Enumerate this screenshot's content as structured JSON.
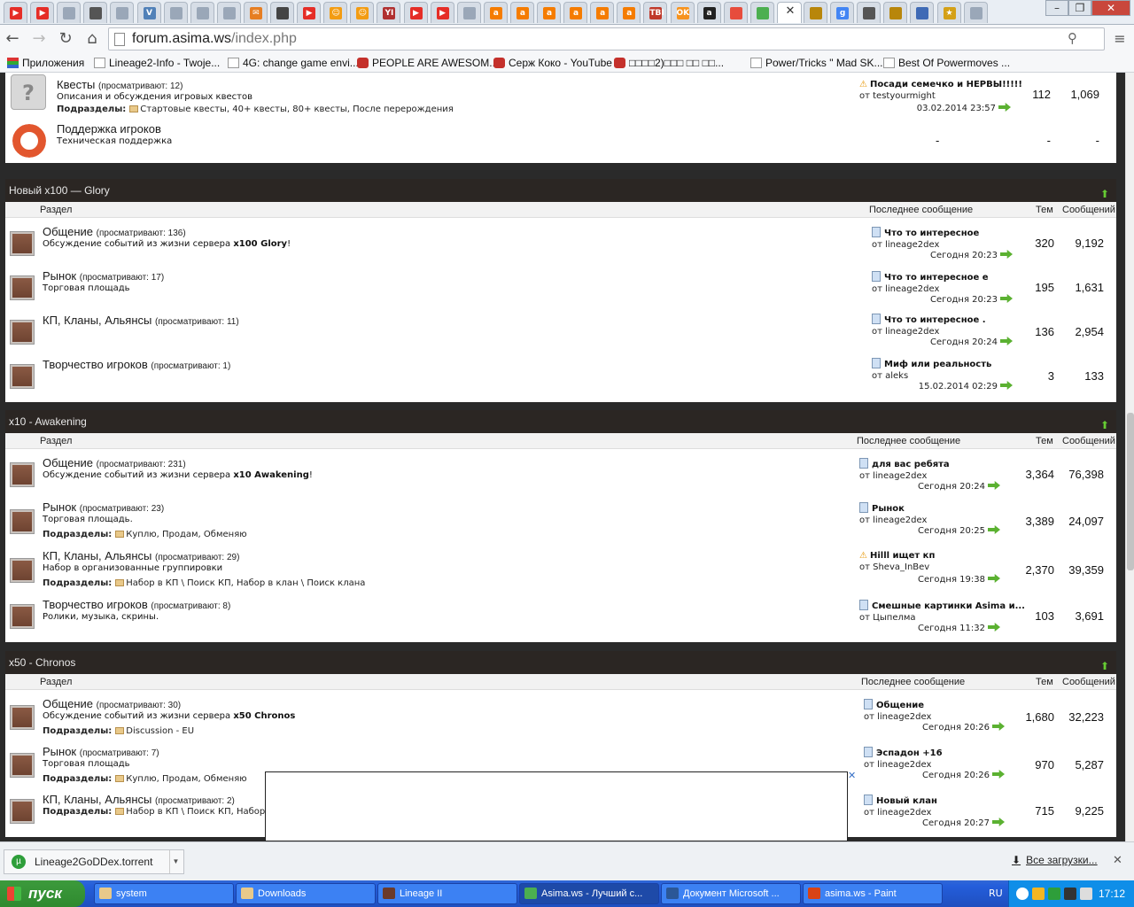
{
  "browser": {
    "url_host": "forum.asima.ws",
    "url_path": "/index.php",
    "tab_icons": [
      "youtube",
      "youtube",
      "page",
      "tool",
      "page",
      "vk",
      "page",
      "page",
      "page",
      "mail",
      "book",
      "youtube",
      "sun",
      "sun",
      "yii",
      "youtube",
      "youtube",
      "page",
      "amazon-a",
      "amazon-a",
      "amazon-a",
      "amazon-a",
      "amazon-a",
      "amazon-a",
      "tbi",
      "ok",
      "amazon",
      "camera",
      "chrome",
      "close",
      "shield",
      "google",
      "image",
      "shield",
      "wing",
      "star",
      "page"
    ],
    "active_tab_close": "✕",
    "bookmarks": [
      {
        "label": "Приложения",
        "icon": "apps"
      },
      {
        "label": "Lineage2-Info - Twoje...",
        "icon": "page"
      },
      {
        "label": "4G: change game envi...",
        "icon": "page"
      },
      {
        "label": "PEOPLE ARE AWESOM...",
        "icon": "yt"
      },
      {
        "label": "Серж Коко - YouTube",
        "icon": "yt"
      },
      {
        "label": "□□□□2)□□□ □□ □□...",
        "icon": "yt"
      },
      {
        "label": "Power/Tricks \" Mad SK...",
        "icon": "page"
      },
      {
        "label": "Best Of Powermoves ...",
        "icon": "page"
      }
    ]
  },
  "forum": {
    "top_rows": [
      {
        "name": "Квесты",
        "viewers": "(просматривают: 12)",
        "desc": "Описания и обсуждения игровых квестов",
        "subs_label": "Подразделы:",
        "subs": "Стартовые квесты, 40+ квесты, 80+ квесты, После перерождения",
        "last_title": "Посади семечко и НЕРВЫ!!!!!",
        "last_by": "от testyourmight",
        "last_date": "03.02.2014 23:57",
        "topics": "112",
        "posts": "1,069"
      },
      {
        "name": "Поддержка игроков",
        "desc": "Техническая поддержка",
        "last_title": "-",
        "topics": "-",
        "posts": "-"
      }
    ],
    "sections": [
      {
        "title": "Новый x100 — Glory",
        "col_section": "Раздел",
        "col_last": "Последнее сообщение",
        "col_topics": "Тем",
        "col_posts": "Сообщений",
        "rows": [
          {
            "name": "Общение",
            "viewers": "(просматривают: 136)",
            "desc": "Обсуждение событий из жизни сервера ",
            "desc_b": "x100 Glory",
            "desc_tail": "!",
            "last_title": "Что то интересное",
            "last_by": "от lineage2dex",
            "last_date": "Сегодня 20:23",
            "topics": "320",
            "posts": "9,192"
          },
          {
            "name": "Рынок",
            "viewers": "(просматривают: 17)",
            "desc": "Торговая площадь",
            "last_title": "Что то интересное е",
            "last_by": "от lineage2dex",
            "last_date": "Сегодня 20:23",
            "topics": "195",
            "posts": "1,631"
          },
          {
            "name": "КП, Кланы, Альянсы",
            "viewers": "(просматривают: 11)",
            "last_title": "Что то интересное .",
            "last_by": "от lineage2dex",
            "last_date": "Сегодня 20:24",
            "topics": "136",
            "posts": "2,954"
          },
          {
            "name": "Творчество игроков",
            "viewers": "(просматривают: 1)",
            "last_title": "Миф или реальность",
            "last_by": "от aleks",
            "last_date": "15.02.2014 02:29",
            "topics": "3",
            "posts": "133"
          }
        ]
      },
      {
        "title": "x10 - Awakening",
        "col_section": "Раздел",
        "col_last": "Последнее сообщение",
        "col_topics": "Тем",
        "col_posts": "Сообщений",
        "rows": [
          {
            "name": "Общение",
            "viewers": "(просматривают: 231)",
            "desc": "Обсуждение событий из жизни сервера ",
            "desc_b": "x10 Awakening",
            "desc_tail": "!",
            "last_title": "для вас ребята",
            "last_by": "от lineage2dex",
            "last_date": "Сегодня 20:24",
            "topics": "3,364",
            "posts": "76,398"
          },
          {
            "name": "Рынок",
            "viewers": "(просматривают: 23)",
            "desc": "Торговая площадь.",
            "subs_label": "Подразделы:",
            "subs": "Куплю, Продам, Обменяю",
            "last_title": "Рынок",
            "last_by": "от lineage2dex",
            "last_date": "Сегодня 20:25",
            "topics": "3,389",
            "posts": "24,097"
          },
          {
            "name": "КП, Кланы, Альянсы",
            "viewers": "(просматривают: 29)",
            "desc": "Набор в организованные группировки",
            "subs_label": "Подразделы:",
            "subs": "Набор в КП \\ Поиск КП, Набор в клан \\ Поиск клана",
            "last_title": "Hilll ищет кп",
            "last_by": "от Sheva_InBev",
            "last_date": "Сегодня 19:38",
            "topics": "2,370",
            "posts": "39,359"
          },
          {
            "name": "Творчество игроков",
            "viewers": "(просматривают: 8)",
            "desc": "Ролики, музыка, скрины.",
            "last_title": "Смешные картинки Asima и...",
            "last_by": "от Цыпелма",
            "last_date": "Сегодня 11:32",
            "topics": "103",
            "posts": "3,691"
          }
        ]
      },
      {
        "title": "x50 - Chronos",
        "col_section": "Раздел",
        "col_last": "Последнее сообщение",
        "col_topics": "Тем",
        "col_posts": "Сообщений",
        "rows": [
          {
            "name": "Общение",
            "viewers": "(просматривают: 30)",
            "desc": "Обсуждение событий из жизни сервера ",
            "desc_b": "x50 Chronos",
            "desc_tail": "",
            "subs_label": "Подразделы:",
            "subs": "Discussion - EU",
            "last_title": "Общение",
            "last_by": "от lineage2dex",
            "last_date": "Сегодня 20:26",
            "topics": "1,680",
            "posts": "32,223"
          },
          {
            "name": "Рынок",
            "viewers": "(просматривают: 7)",
            "desc": "Торговая площадь",
            "subs_label": "Подразделы:",
            "subs": "Куплю, Продам, Обменяю",
            "last_title": "Эспадон +16",
            "last_by": "от lineage2dex",
            "last_date": "Сегодня 20:26",
            "topics": "970",
            "posts": "5,287"
          },
          {
            "name": "КП, Кланы, Альянсы",
            "viewers": "(просматривают: 2)",
            "subs_label": "Подразделы:",
            "subs": "Набор в КП \\ Поиск КП, Набор в",
            "last_title": "Новый клан",
            "last_by": "от lineage2dex",
            "last_date": "Сегодня 20:27",
            "topics": "715",
            "posts": "9,225"
          }
        ]
      }
    ]
  },
  "downloads": {
    "file": "Lineage2GoDDex.torrent",
    "all": "Все загрузки...",
    "close": "✕"
  },
  "taskbar": {
    "start": "пуск",
    "items": [
      "system",
      "Downloads",
      "Lineage II",
      "Asima.ws - Лучший с...",
      "Документ Microsoft ...",
      "asima.ws - Paint"
    ],
    "lang": "RU",
    "time": "17:12"
  },
  "colors": {
    "cat_header": "#2b2623",
    "accent_green": "#5bb131",
    "taskbar": "#245edb"
  }
}
